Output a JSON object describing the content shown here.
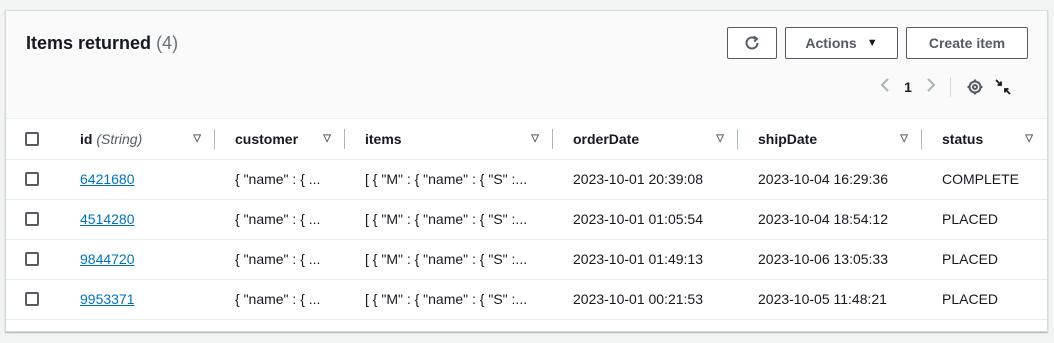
{
  "header": {
    "title": "Items returned",
    "count": "(4)"
  },
  "buttons": {
    "refresh_icon": "refresh-icon",
    "actions_label": "Actions",
    "create_label": "Create item"
  },
  "pagination": {
    "current_page": "1",
    "prev_icon": "chevron-left-icon",
    "next_icon": "chevron-right-icon",
    "settings_icon": "gear-icon",
    "collapse_icon": "collapse-icon"
  },
  "columns": [
    {
      "label": "id",
      "type_hint": "(String)"
    },
    {
      "label": "customer"
    },
    {
      "label": "items"
    },
    {
      "label": "orderDate"
    },
    {
      "label": "shipDate"
    },
    {
      "label": "status"
    }
  ],
  "rows": [
    {
      "id": "6421680",
      "customer": "{ \"name\" : { ...",
      "items": "[ { \"M\" : { \"name\" : { \"S\" :...",
      "orderDate": "2023-10-01 20:39:08",
      "shipDate": "2023-10-04 16:29:36",
      "status": "COMPLETE"
    },
    {
      "id": "4514280",
      "customer": "{ \"name\" : { ...",
      "items": "[ { \"M\" : { \"name\" : { \"S\" :...",
      "orderDate": "2023-10-01 01:05:54",
      "shipDate": "2023-10-04 18:54:12",
      "status": "PLACED"
    },
    {
      "id": "9844720",
      "customer": "{ \"name\" : { ...",
      "items": "[ { \"M\" : { \"name\" : { \"S\" :...",
      "orderDate": "2023-10-01 01:49:13",
      "shipDate": "2023-10-06 13:05:33",
      "status": "PLACED"
    },
    {
      "id": "9953371",
      "customer": "{ \"name\" : { ...",
      "items": "[ { \"M\" : { \"name\" : { \"S\" :...",
      "orderDate": "2023-10-01 00:21:53",
      "shipDate": "2023-10-05 11:48:21",
      "status": "PLACED"
    }
  ],
  "colors": {
    "link": "#0073bb",
    "border": "#eaeded",
    "text": "#16191f"
  }
}
